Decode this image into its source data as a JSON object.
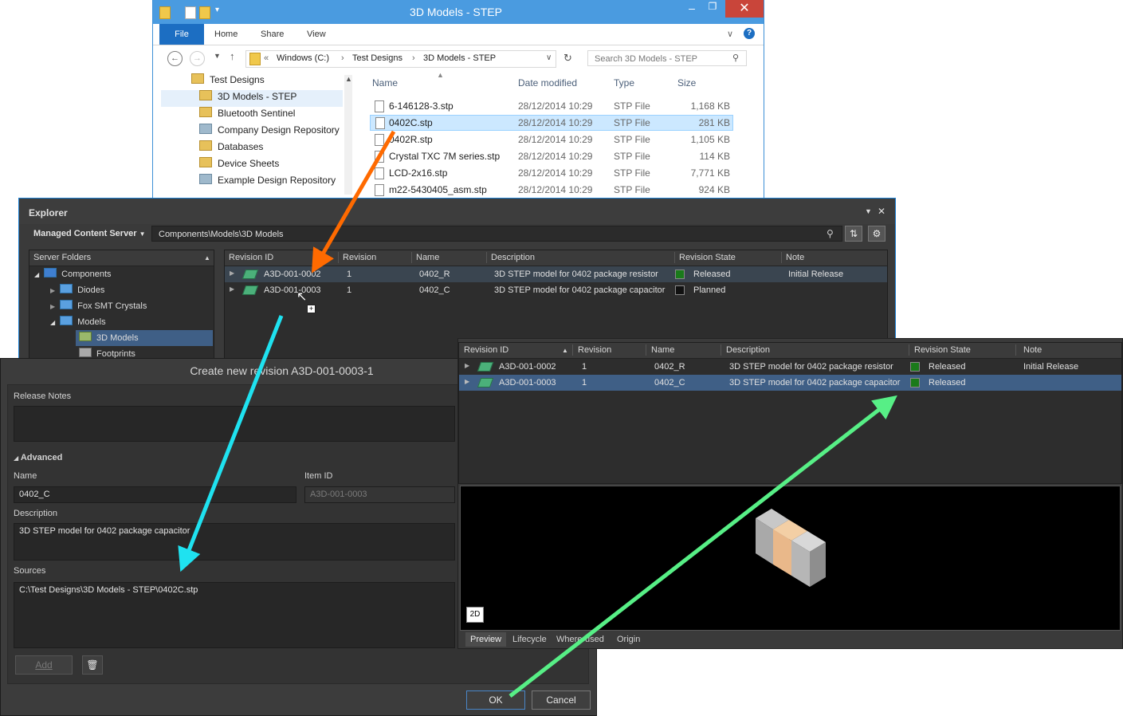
{
  "file_explorer": {
    "title": "3D Models - STEP",
    "ribbon_tabs": [
      "File",
      "Home",
      "Share",
      "View"
    ],
    "breadcrumb": [
      "«",
      "Windows (C:)",
      "Test Designs",
      "3D Models - STEP"
    ],
    "search_placeholder": "Search 3D Models - STEP",
    "nav_tree": [
      "Test Designs",
      "3D Models - STEP",
      "Bluetooth Sentinel",
      "Company Design Repository",
      "Databases",
      "Device Sheets",
      "Example Design Repository"
    ],
    "columns": [
      "Name",
      "Date modified",
      "Type",
      "Size"
    ],
    "files": [
      {
        "name": "6-146128-3.stp",
        "date": "28/12/2014 10:29",
        "type": "STP File",
        "size": "1,168 KB"
      },
      {
        "name": "0402C.stp",
        "date": "28/12/2014 10:29",
        "type": "STP File",
        "size": "281 KB"
      },
      {
        "name": "0402R.stp",
        "date": "28/12/2014 10:29",
        "type": "STP File",
        "size": "1,105 KB"
      },
      {
        "name": "Crystal TXC 7M series.stp",
        "date": "28/12/2014 10:29",
        "type": "STP File",
        "size": "114 KB"
      },
      {
        "name": "LCD-2x16.stp",
        "date": "28/12/2014 10:29",
        "type": "STP File",
        "size": "7,771 KB"
      },
      {
        "name": "m22-5430405_asm.stp",
        "date": "28/12/2014 10:29",
        "type": "STP File",
        "size": "924 KB"
      }
    ]
  },
  "explorer_panel": {
    "title": "Explorer",
    "server": "Managed Content Server",
    "path": "Components\\Models\\3D Models",
    "folders_header": "Server Folders",
    "folders": [
      "Components",
      "Diodes",
      "Fox SMT Crystals",
      "Models",
      "3D Models",
      "Footprints"
    ],
    "columns": [
      "Revision ID",
      "Revision",
      "Name",
      "Description",
      "Revision State",
      "Note"
    ],
    "rows": [
      {
        "id": "A3D-001-0002",
        "rev": "1",
        "name": "0402_R",
        "desc": "3D STEP model for 0402 package resistor",
        "state": "Released",
        "note": "Initial Release"
      },
      {
        "id": "A3D-001-0003",
        "rev": "1",
        "name": "0402_C",
        "desc": "3D STEP model for 0402 package capacitor",
        "state": "Planned",
        "note": ""
      }
    ]
  },
  "dialog": {
    "title": "Create new revision A3D-001-0003-1",
    "release_notes_label": "Release Notes",
    "advanced_label": "Advanced",
    "name_label": "Name",
    "name_value": "0402_C",
    "item_id_label": "Item ID",
    "item_id_value": "A3D-001-0003",
    "description_label": "Description",
    "description_value": "3D STEP model for 0402 package capacitor",
    "sources_label": "Sources",
    "sources_value": "C:\\Test Designs\\3D Models - STEP\\0402C.stp",
    "add_label": "Add",
    "ok_label": "OK",
    "cancel_label": "Cancel"
  },
  "result_panel": {
    "columns": [
      "Revision ID",
      "Revision",
      "Name",
      "Description",
      "Revision State",
      "Note"
    ],
    "rows": [
      {
        "id": "A3D-001-0002",
        "rev": "1",
        "name": "0402_R",
        "desc": "3D STEP model for 0402 package resistor",
        "state": "Released",
        "note": "Initial Release"
      },
      {
        "id": "A3D-001-0003",
        "rev": "1",
        "name": "0402_C",
        "desc": "3D STEP model for 0402 package capacitor",
        "state": "Released",
        "note": ""
      }
    ],
    "view_mode": "2D",
    "tabs": [
      "Preview",
      "Lifecycle",
      "Where-used",
      "Origin"
    ]
  },
  "colors": {
    "released": "#1a7a1a",
    "planned": "#111111",
    "arrow_orange": "#ff6a00",
    "arrow_cyan": "#1fe2f0",
    "arrow_green": "#57ef86"
  }
}
